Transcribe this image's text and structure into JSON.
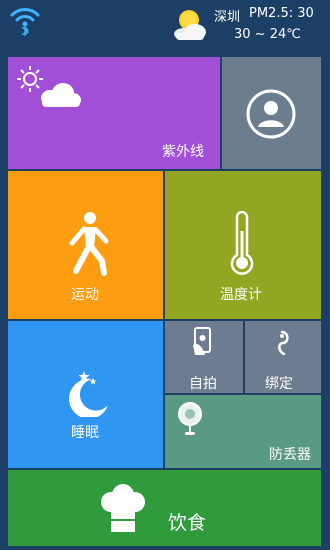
{
  "status": {
    "icons": {
      "wifi": "wifi-icon",
      "bluetooth": "bluetooth-icon",
      "weather": "sun-cloud-icon"
    }
  },
  "weather": {
    "city": "深圳",
    "pm25": "PM2.5: 30",
    "temperature": "30 ~ 24℃"
  },
  "tiles": {
    "uv": {
      "label": "紫外线",
      "icon": "sun-cloud-icon",
      "color": "#a04fd6"
    },
    "avatar": {
      "icon": "user-avatar-icon",
      "color": "#6c7d8f"
    },
    "sport": {
      "label": "运动",
      "icon": "walking-person-icon",
      "color": "#ff9d12"
    },
    "thermometer": {
      "label": "温度计",
      "icon": "thermometer-icon",
      "color": "#93a624"
    },
    "sleep": {
      "label": "睡眠",
      "icon": "moon-stars-icon",
      "color": "#2f96f2"
    },
    "selfie": {
      "label": "自拍",
      "icon": "phone-camera-icon",
      "color": "#6d7c90"
    },
    "bind": {
      "label": "绑定",
      "icon": "bind-device-icon",
      "color": "#6d7c90"
    },
    "antilost": {
      "label": "防丢器",
      "icon": "anti-lost-tracker-icon",
      "color": "#5b9a82"
    },
    "diet": {
      "label": "饮食",
      "icon": "chef-hat-icon",
      "color": "#2f9b3b"
    }
  }
}
